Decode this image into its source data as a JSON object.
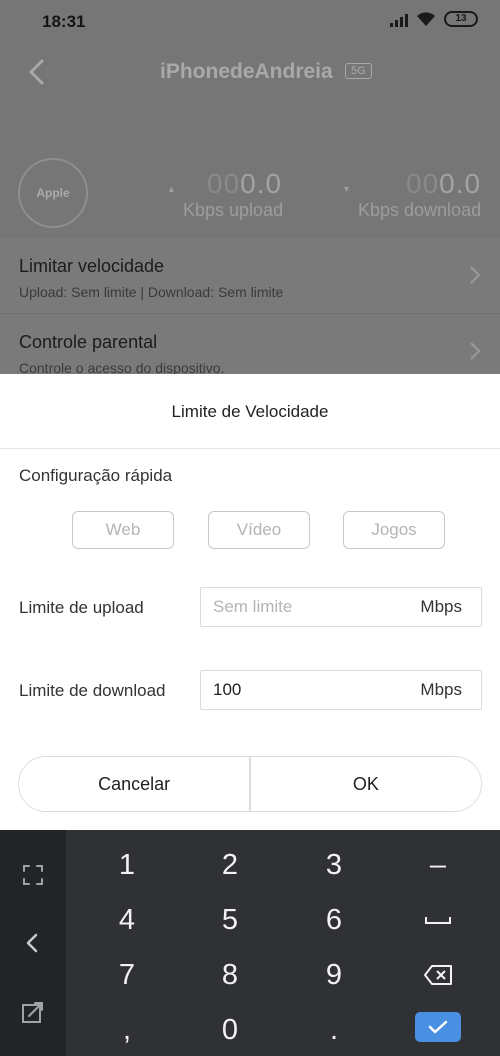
{
  "status_bar": {
    "time": "18:31",
    "battery": "13"
  },
  "header": {
    "device_name": "iPhonedeAndreia",
    "band": "5G",
    "avatar_label": "Apple",
    "upload": {
      "value_dim": "00",
      "value_main": "0.0",
      "unit": "Kbps upload"
    },
    "download": {
      "value_dim": "00",
      "value_main": "0.0",
      "unit": "Kbps download"
    }
  },
  "list": {
    "items": [
      {
        "title": "Limitar velocidade",
        "subtitle": "Upload: Sem limite | Download: Sem limite"
      },
      {
        "title": "Controle parental",
        "subtitle": "Controle o acesso do dispositivo."
      }
    ]
  },
  "dialog": {
    "title": "Limite de Velocidade",
    "quick_config_label": "Configuração rápida",
    "presets": [
      "Web",
      "Vídeo",
      "Jogos"
    ],
    "upload": {
      "label": "Limite de upload",
      "placeholder": "Sem limite",
      "value": "",
      "unit": "Mbps"
    },
    "download": {
      "label": "Limite de download",
      "value": "100",
      "unit": "Mbps"
    },
    "cancel_label": "Cancelar",
    "ok_label": "OK"
  },
  "keyboard": {
    "keys": [
      "1",
      "2",
      "3",
      "–",
      "4",
      "5",
      "6",
      "␣",
      "7",
      "8",
      "9",
      "⌫",
      ",",
      "0",
      ".",
      "✓"
    ],
    "side_icons": [
      "expand-icon",
      "back-arrow-icon",
      "resize-icon"
    ],
    "accent_color": "#4a90e2"
  }
}
